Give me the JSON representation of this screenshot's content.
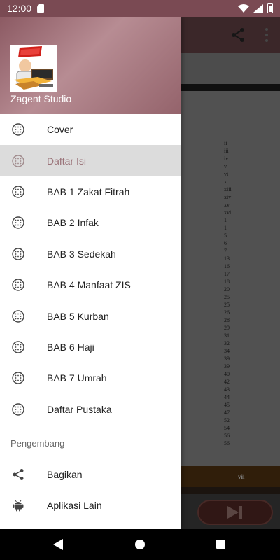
{
  "status_bar": {
    "time": "12:00"
  },
  "drawer": {
    "header": {
      "title": "Zagent Studio"
    },
    "items": [
      {
        "label": "Cover",
        "icon": "dots-grid-icon",
        "selected": false
      },
      {
        "label": "Daftar Isi",
        "icon": "dots-grid-icon",
        "selected": true
      },
      {
        "label": "BAB 1 Zakat Fitrah",
        "icon": "dots-grid-icon",
        "selected": false
      },
      {
        "label": "BAB 2 Infak",
        "icon": "dots-grid-icon",
        "selected": false
      },
      {
        "label": "BAB 3 Sedekah",
        "icon": "dots-grid-icon",
        "selected": false
      },
      {
        "label": "BAB 4 Manfaat ZIS",
        "icon": "dots-grid-icon",
        "selected": false
      },
      {
        "label": "BAB 5 Kurban",
        "icon": "dots-grid-icon",
        "selected": false
      },
      {
        "label": "BAB 6 Haji",
        "icon": "dots-grid-icon",
        "selected": false
      },
      {
        "label": "BAB 7 Umrah",
        "icon": "dots-grid-icon",
        "selected": false
      },
      {
        "label": "Daftar Pustaka",
        "icon": "dots-grid-icon",
        "selected": false
      }
    ],
    "section_title": "Pengembang",
    "developer_items": [
      {
        "label": "Bagikan",
        "icon": "share-icon"
      },
      {
        "label": "Aplikasi Lain",
        "icon": "android-icon"
      }
    ]
  },
  "document": {
    "page_numbers": [
      "ii",
      "iii",
      "iv",
      "v",
      "vi",
      "x",
      "xiii",
      "xiv",
      "xv",
      "xvi",
      "1",
      "1",
      "5",
      "6",
      "7",
      "13",
      "16",
      "17",
      "18",
      "20",
      "25",
      "25",
      "26",
      "28",
      "29",
      "31",
      "32",
      "34",
      "39",
      "39",
      "40",
      "42",
      "43",
      "44",
      "45",
      "47",
      "52",
      "54",
      "56",
      "56"
    ],
    "footer_page": "vii"
  },
  "colors": {
    "header_gradient_start": "#8c5a63",
    "selected_text": "#9a7278",
    "selected_bg": "#dcdcdc"
  }
}
